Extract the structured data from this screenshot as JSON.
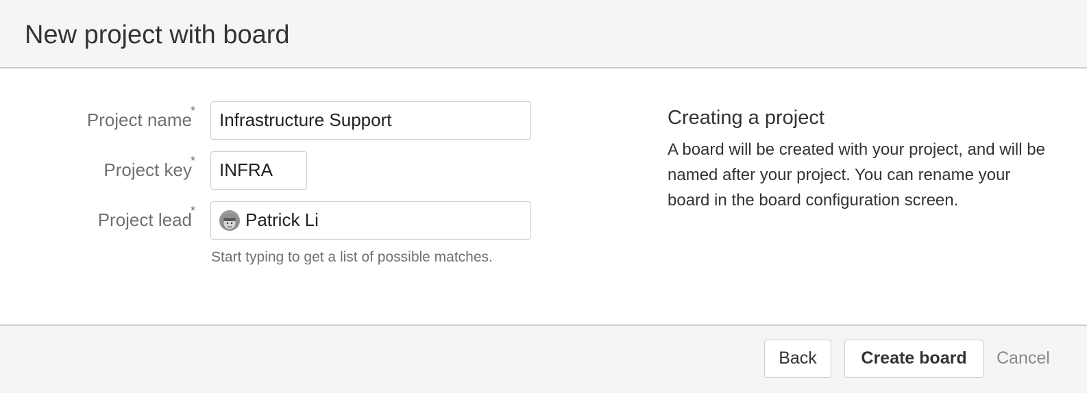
{
  "dialog": {
    "title": "New project with board"
  },
  "form": {
    "project_name": {
      "label": "Project name",
      "required_marker": "*",
      "value": "Infrastructure Support"
    },
    "project_key": {
      "label": "Project key",
      "required_marker": "*",
      "value": "INFRA"
    },
    "project_lead": {
      "label": "Project lead",
      "required_marker": "*",
      "value": "Patrick Li",
      "avatar_icon": "user-avatar-icon",
      "help_text": "Start typing to get a list of possible matches."
    }
  },
  "info": {
    "title": "Creating a project",
    "body": "A board will be created with your project, and will be named after your project. You can rename your board in the board configuration screen."
  },
  "footer": {
    "back_label": "Back",
    "create_label": "Create board",
    "cancel_label": "Cancel"
  },
  "colors": {
    "header_bg": "#f5f5f5",
    "border": "#cccccc",
    "label_text": "#707070",
    "body_text": "#333333",
    "cancel_link": "#8a8a8a"
  }
}
